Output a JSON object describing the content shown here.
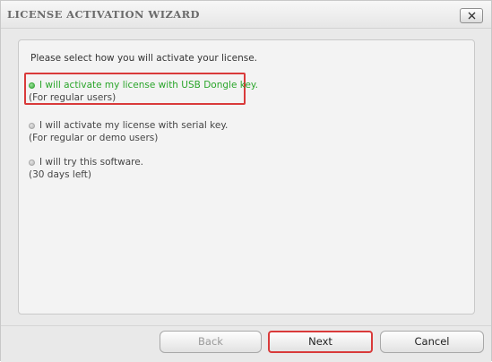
{
  "window": {
    "title": "LICENSE ACTIVATION WIZARD",
    "close_icon": "close-x-icon"
  },
  "content": {
    "prompt": "Please select how you will activate your license.",
    "options": [
      {
        "label": "I will activate my license with USB Dongle key.",
        "sublabel": "(For regular users)",
        "selected": true
      },
      {
        "label": "I will activate my license with serial key.",
        "sublabel": "(For regular or demo users)",
        "selected": false
      },
      {
        "label": "I will try this software.",
        "sublabel": "(30 days left)",
        "selected": false
      }
    ]
  },
  "buttons": {
    "back": "Back",
    "next": "Next",
    "cancel": "Cancel"
  },
  "colors": {
    "selected_option_text": "#2aa52a",
    "highlight_border": "#d93a3a"
  }
}
